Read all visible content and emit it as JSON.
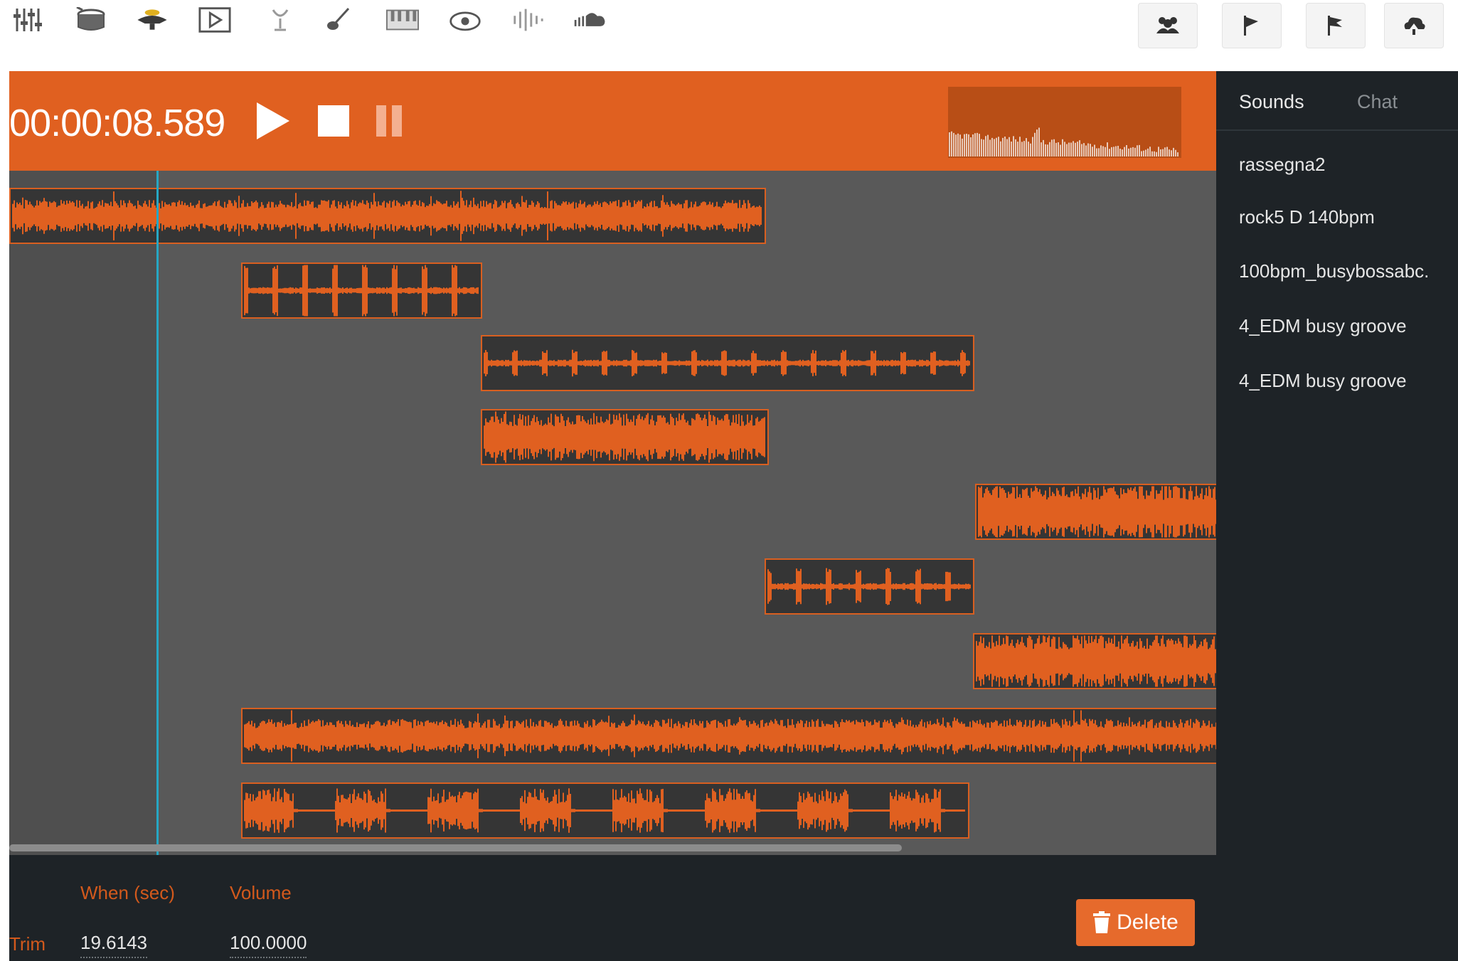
{
  "toolbar": {
    "icons": [
      "mixer-icon",
      "drum-icon",
      "lamp-icon",
      "play-box-icon",
      "microphone-icon",
      "guitar-icon",
      "keyboard-icon",
      "eye-icon",
      "waveform-icon",
      "soundcloud-icon"
    ],
    "right_buttons": [
      "users-icon",
      "flag-icon",
      "flag-alt-icon",
      "cloud-upload-icon"
    ]
  },
  "transport": {
    "time": "00:00:08.589"
  },
  "sidebar": {
    "tabs": {
      "sounds": "Sounds",
      "chat": "Chat"
    },
    "sounds": [
      "rassegna2",
      "rock5 D 140bpm",
      "100bpm_busybossabc.",
      "4_EDM busy groove",
      "4_EDM busy groove"
    ]
  },
  "bottom": {
    "when_label": "When (sec)",
    "volume_label": "Volume",
    "trim_label": "Trim",
    "when_value": "19.6143",
    "volume_value": "100.0000",
    "delete_label": "Delete"
  },
  "colors": {
    "accent": "#e06020",
    "track_bg": "#595959",
    "clip_bg": "#353535",
    "playhead": "#26a7c4",
    "panel": "#1e2327"
  }
}
